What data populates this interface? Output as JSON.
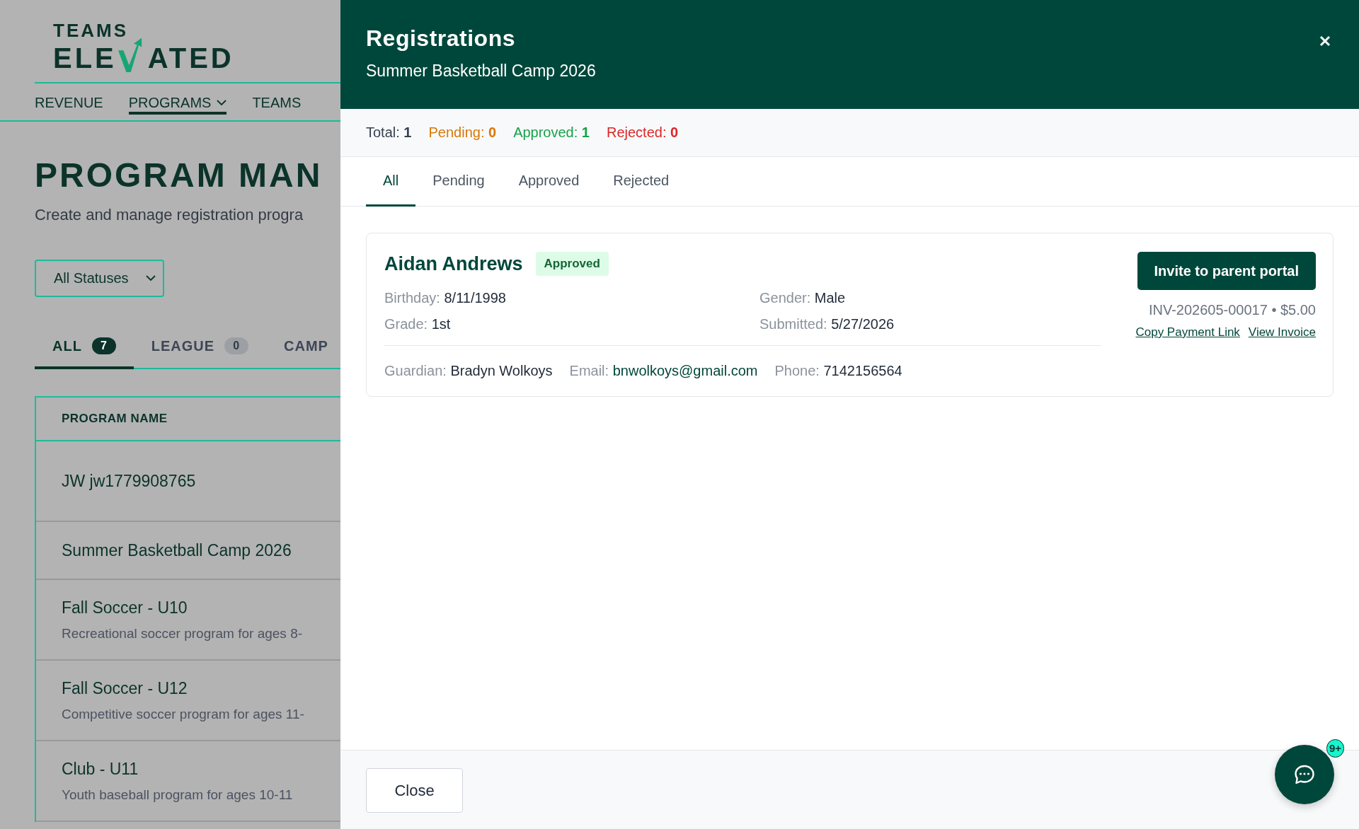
{
  "app": {
    "logo": {
      "line_1": "TEAMS",
      "line_2_start": "ELE",
      "line_2_end": "ATED"
    },
    "nav": [
      {
        "label": "REVENUE",
        "selected": false,
        "has_menu": false
      },
      {
        "label": "PROGRAMS",
        "selected": true,
        "has_menu": true
      },
      {
        "label": "TEAMS",
        "selected": false,
        "has_menu": false
      }
    ],
    "title": "PROGRAM MAN",
    "subtitle": "Create and manage registration progra",
    "status_filter": {
      "value": "All Statuses"
    },
    "type_tabs": [
      {
        "label": "ALL",
        "count": "7",
        "selected": true
      },
      {
        "label": "LEAGUE",
        "count": "0",
        "selected": false
      },
      {
        "label": "CAMP",
        "selected": false
      }
    ],
    "table": {
      "columns": [
        "PROGRAM NAME"
      ],
      "rows": [
        {
          "name": "JW jw1779908765"
        },
        {
          "name": "Summer Basketball Camp 2026"
        },
        {
          "name": "Fall Soccer - U10",
          "description": "Recreational soccer program for ages 8-"
        },
        {
          "name": "Fall Soccer - U12",
          "description": "Competitive soccer program for ages 11-"
        },
        {
          "name": "Club - U11",
          "description": "Youth baseball program for ages 10-11"
        }
      ]
    }
  },
  "drawer": {
    "title": "Registrations",
    "subtitle": "Summer Basketball Camp 2026",
    "summary": [
      {
        "label": "Total:",
        "value": "1",
        "color": "#374151"
      },
      {
        "label": "Pending:",
        "value": "0",
        "color": "#d97706"
      },
      {
        "label": "Approved:",
        "value": "1",
        "color": "#16a34a"
      },
      {
        "label": "Rejected:",
        "value": "0",
        "color": "#dc2626"
      }
    ],
    "tabs": [
      {
        "label": "All",
        "selected": true
      },
      {
        "label": "Pending",
        "selected": false
      },
      {
        "label": "Approved",
        "selected": false
      },
      {
        "label": "Rejected",
        "selected": false
      }
    ],
    "registrations": [
      {
        "name": "Aidan Andrews",
        "status": {
          "label": "Approved",
          "kind": "approved"
        },
        "fields": [
          {
            "label": "Birthday:",
            "value": "8/11/1998"
          },
          {
            "label": "Gender:",
            "value": "Male"
          },
          {
            "label": "Grade:",
            "value": "1st"
          },
          {
            "label": "Submitted:",
            "value": "5/27/2026"
          }
        ],
        "contacts": [
          {
            "label": "Guardian:",
            "value": "Bradyn Wolkoys",
            "kind": "text"
          },
          {
            "label": "Email:",
            "value": "bnwolkoys@gmail.com",
            "kind": "email"
          },
          {
            "label": "Phone:",
            "value": "7142156564",
            "kind": "text"
          }
        ],
        "action": "Invite to parent portal",
        "invoice": "INV-202605-00017 • $5.00",
        "links": [
          "Copy Payment Link",
          "View Invoice"
        ]
      }
    ],
    "close_button": "Close"
  },
  "chat": {
    "badge": "9+"
  }
}
